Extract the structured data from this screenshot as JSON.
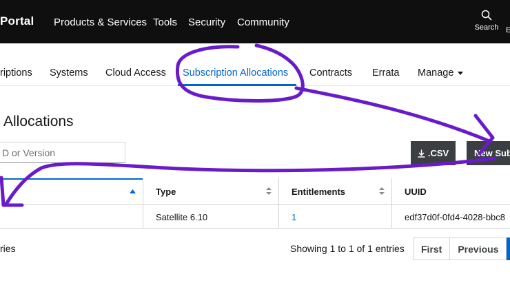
{
  "masthead": {
    "brand": "Portal",
    "nav": [
      "Products & Services",
      "Tools",
      "Security",
      "Community"
    ],
    "search_label": "Search",
    "clipped_label": "E"
  },
  "subnav": {
    "items": [
      "riptions",
      "Systems",
      "Cloud Access",
      "Subscription Allocations",
      "Contracts",
      "Errata",
      "Manage"
    ],
    "active": "Subscription Allocations"
  },
  "page": {
    "title": "Allocations",
    "search_placeholder": "D or Version"
  },
  "toolbar": {
    "csv_label": ".CSV",
    "new_label": "New Subscription Allocation"
  },
  "table": {
    "columns": [
      "",
      "Type",
      "Entitlements",
      "UUID"
    ],
    "rows": [
      {
        "name": "",
        "type": "Satellite 6.10",
        "entitlements": "1",
        "uuid": "edf37d0f-0fd4-4028-bbc8"
      }
    ]
  },
  "footer": {
    "left_text": "ries",
    "showing": "Showing 1 to 1 of 1 entries",
    "pagination": [
      "First",
      "Previous"
    ]
  },
  "colors": {
    "accent": "#0066cc",
    "masthead": "#0f0f0f",
    "annotation": "#6a1bc9",
    "button_dark": "#3c3f42"
  },
  "icons": [
    "search-icon",
    "download-icon",
    "sort-asc-icon",
    "sort-icon",
    "caret-down-icon"
  ]
}
